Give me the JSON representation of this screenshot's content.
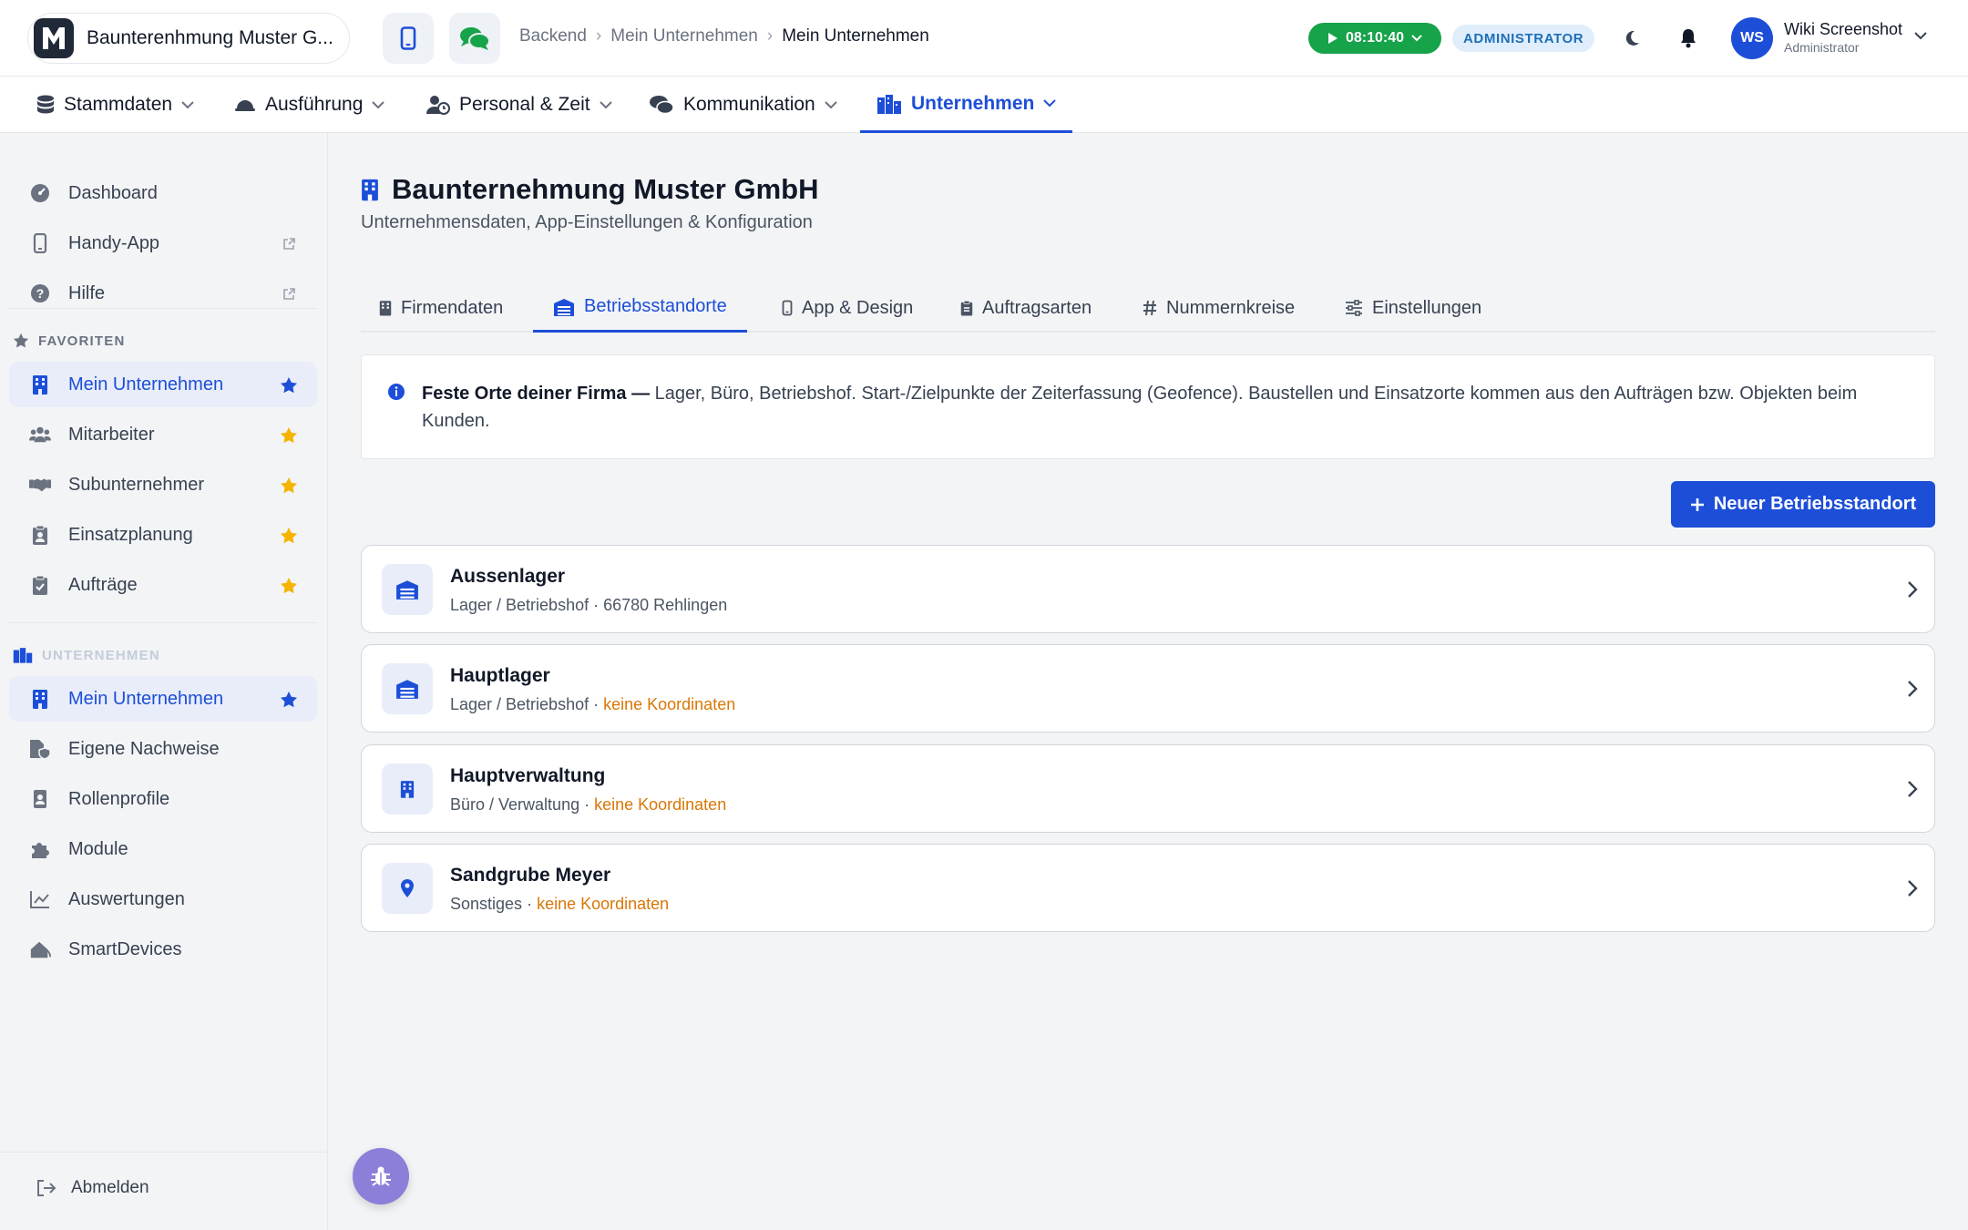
{
  "brand": {
    "name": "Baunterenhmung Muster G...",
    "logo_letter": "M"
  },
  "breadcrumb": {
    "items": [
      "Backend",
      "Mein Unternehmen"
    ],
    "current": "Mein Unternehmen"
  },
  "timer": {
    "value": "08:10:40",
    "color": "#16a34a"
  },
  "role_badge": "ADMINISTRATOR",
  "user": {
    "initials": "WS",
    "name": "Wiki Screenshot",
    "role": "Administrator"
  },
  "nav": {
    "items": [
      {
        "label": "Stammdaten",
        "icon": "database-icon"
      },
      {
        "label": "Ausführung",
        "icon": "helmet-icon"
      },
      {
        "label": "Personal & Zeit",
        "icon": "user-clock-icon"
      },
      {
        "label": "Kommunikation",
        "icon": "comments-icon"
      },
      {
        "label": "Unternehmen",
        "icon": "city-icon",
        "active": true
      }
    ]
  },
  "sidebar": {
    "top_items": [
      {
        "label": "Dashboard",
        "icon": "gauge-icon"
      },
      {
        "label": "Handy-App",
        "icon": "mobile-icon",
        "external": true
      },
      {
        "label": "Hilfe",
        "icon": "question-icon",
        "external": true
      }
    ],
    "favorites_title": "FAVORITEN",
    "favorites": [
      {
        "label": "Mein Unternehmen",
        "icon": "building-icon",
        "active": true
      },
      {
        "label": "Mitarbeiter",
        "icon": "users-icon"
      },
      {
        "label": "Subunternehmer",
        "icon": "handshake-icon"
      },
      {
        "label": "Einsatzplanung",
        "icon": "clipboard-user-icon"
      },
      {
        "label": "Aufträge",
        "icon": "clipboard-check-icon"
      }
    ],
    "company_title": "UNTERNEHMEN",
    "company": [
      {
        "label": "Mein Unternehmen",
        "icon": "building-icon",
        "active": true
      },
      {
        "label": "Eigene Nachweise",
        "icon": "file-shield-icon"
      },
      {
        "label": "Rollenprofile",
        "icon": "id-badge-icon"
      },
      {
        "label": "Module",
        "icon": "puzzle-icon"
      },
      {
        "label": "Auswertungen",
        "icon": "chart-line-icon"
      },
      {
        "label": "SmartDevices",
        "icon": "house-signal-icon"
      }
    ],
    "logout": "Abmelden"
  },
  "page": {
    "title": "Baunternehmung Muster GmbH",
    "subtitle": "Unternehmensdaten, App-Einstellungen & Konfiguration"
  },
  "tabs": [
    {
      "label": "Firmendaten",
      "icon": "building-icon"
    },
    {
      "label": "Betriebsstandorte",
      "icon": "warehouse-icon",
      "active": true
    },
    {
      "label": "App & Design",
      "icon": "mobile-icon"
    },
    {
      "label": "Auftragsarten",
      "icon": "clipboard-icon"
    },
    {
      "label": "Nummernkreise",
      "icon": "hashtag-icon"
    },
    {
      "label": "Einstellungen",
      "icon": "sliders-icon"
    }
  ],
  "info": {
    "bold": "Feste Orte deiner Firma —",
    "text": " Lager, Büro, Betriebshof. Start-/Zielpunkte der Zeiterfassung (Geofence). Baustellen und Einsatzorte kommen aus den Aufträgen bzw. Objekten beim Kunden."
  },
  "new_button": "Neuer Betriebsstandort",
  "locations": [
    {
      "name": "Aussenlager",
      "type": "Lager / Betriebshof",
      "detail": "66780 Rehlingen",
      "warning": "",
      "icon": "warehouse-icon"
    },
    {
      "name": "Hauptlager",
      "type": "Lager / Betriebshof",
      "detail": "",
      "warning": "keine Koordinaten",
      "icon": "warehouse-icon"
    },
    {
      "name": "Hauptverwaltung",
      "type": "Büro / Verwaltung",
      "detail": "",
      "warning": "keine Koordinaten",
      "icon": "building-icon"
    },
    {
      "name": "Sandgrube Meyer",
      "type": "Sonstiges",
      "detail": "",
      "warning": "keine Koordinaten",
      "icon": "location-pin-icon"
    }
  ],
  "colors": {
    "accent": "#1d4ed8",
    "warning": "#d97706",
    "star": "#f5b400",
    "success": "#16a34a"
  }
}
